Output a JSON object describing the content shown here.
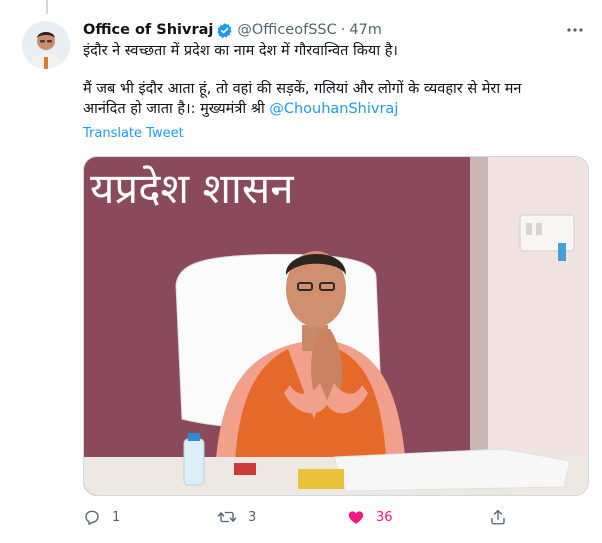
{
  "tweet": {
    "author_name": "Office of Shivraj",
    "handle": "@OfficeofSSC",
    "separator": "·",
    "time": "47m",
    "line1": "इंदौर ने स्वच्छता में प्रदेश का नाम देश में गौरवान्वित किया है।",
    "line2_part1": "मैं जब भी इंदौर आता हूं, तो वहां की सड़कें, गलियां और लोगों के व्यवहार से मेरा मन",
    "line2_part2": "आनंदित हो जाता है।: मुख्यमंत्री श्री ",
    "mention": "@ChouhanShivraj",
    "translate_label": "Translate Tweet",
    "media_wall_text": "यप्रदेश शासन",
    "reply_count": "1",
    "retweet_count": "3",
    "like_count": "36"
  },
  "colors": {
    "accent": "#1d9bf0",
    "like": "#f91880",
    "secondary_text": "#536471",
    "wall": "#8a4a5b"
  },
  "icons": {
    "verified": "verified-badge-icon",
    "more": "more-dots-icon",
    "reply": "reply-icon",
    "retweet": "retweet-icon",
    "like": "heart-icon",
    "share": "share-icon"
  }
}
